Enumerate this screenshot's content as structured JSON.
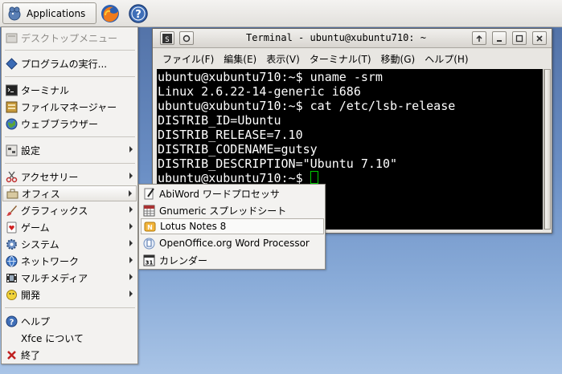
{
  "panel": {
    "applications_label": "Applications",
    "icons": [
      "xfce-mouse-icon",
      "firefox-icon",
      "help-icon"
    ]
  },
  "menu": {
    "desktop_menu": "デスクトップメニュー",
    "run_program": "プログラムの実行...",
    "terminal": "ターミナル",
    "file_manager": "ファイルマネージャー",
    "web_browser": "ウェブブラウザー",
    "settings": "設定",
    "accessories": "アクセサリー",
    "office": "オフィス",
    "graphics": "グラフィックス",
    "games": "ゲーム",
    "system": "システム",
    "network": "ネットワーク",
    "multimedia": "マルチメディア",
    "development": "開発",
    "help": "ヘルプ",
    "about_xfce": "Xfce について",
    "quit": "終了"
  },
  "submenu": {
    "items": [
      "AbiWord ワードプロセッサ",
      "Gnumeric スプレッドシート",
      "Lotus Notes 8",
      "OpenOffice.org Word Processor",
      "カレンダー"
    ],
    "highlighted_index": 2
  },
  "terminal": {
    "title": "Terminal - ubuntu@xubuntu710: ~",
    "menubar": [
      "ファイル(F)",
      "編集(E)",
      "表示(V)",
      "ターミナル(T)",
      "移動(G)",
      "ヘルプ(H)"
    ],
    "lines": [
      "ubuntu@xubuntu710:~$ uname -srm",
      "Linux 2.6.22-14-generic i686",
      "ubuntu@xubuntu710:~$ cat /etc/lsb-release",
      "DISTRIB_ID=Ubuntu",
      "DISTRIB_RELEASE=7.10",
      "DISTRIB_CODENAME=gutsy",
      "DISTRIB_DESCRIPTION=\"Ubuntu 7.10\""
    ],
    "prompt": "ubuntu@xubuntu710:~$ "
  },
  "colors": {
    "desktop_top": "#4f6ea3",
    "desktop_bottom": "#a9c4e6",
    "terminal_bg": "#000000",
    "terminal_fg": "#ffffff",
    "cursor": "#00cc00"
  }
}
